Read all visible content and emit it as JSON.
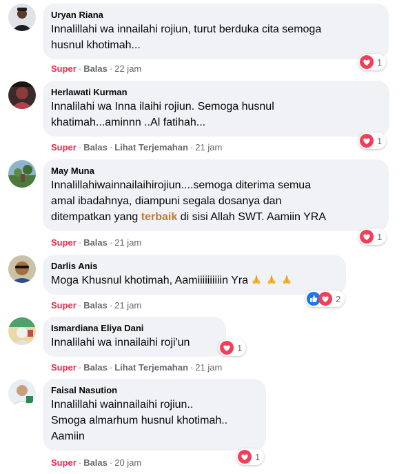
{
  "comments": [
    {
      "author": "Uryan Riana",
      "text": "Innalillahi wa innailahi rojiun, turut berduka cita semoga\nhusnul khotimah...",
      "actions": {
        "super": "Super",
        "reply": "Balas",
        "time": "22 jam"
      },
      "reaction_count": "1"
    },
    {
      "author": "Herlawati Kurman",
      "text": "Innalilahi wa Inna ilaihi rojiun. Semoga husnul\nkhatimah...aminnn ..Al fatihah...",
      "actions": {
        "super": "Super",
        "reply": "Balas",
        "translate": "Lihat Terjemahan",
        "time": "21 jam"
      },
      "reaction_count": "1"
    },
    {
      "author": "May Muna",
      "text_before": "Innalillahiwainnailaihirojiun....semoga diterima semua\namal ibadahnya, diampuni segala dosanya dan\nditempatkan yang ",
      "text_highlight": "terbaik",
      "text_after": " di sisi Allah SWT. Aamiin YRA",
      "actions": {
        "super": "Super",
        "reply": "Balas",
        "time": "21 jam"
      },
      "reaction_count": "1"
    },
    {
      "author": "Darlis Anis",
      "text": "Moga Khusnul khotimah, Aamiiiiiiiiiin Yra",
      "actions": {
        "super": "Super",
        "reply": "Balas",
        "time": "21 jam"
      },
      "reaction_count": "2"
    },
    {
      "author": "Ismardiana Eliya Dani",
      "text": "Innalilahi wa innailaihi roji'un",
      "actions": {
        "super": "Super",
        "reply": "Balas",
        "translate": "Lihat Terjemahan",
        "time": "21 jam"
      },
      "reaction_count": "1"
    },
    {
      "author": "Faisal Nasution",
      "text": "Innalillahi wainnailaihi rojiun..\nSmoga almarhum husnul khotimah..\nAamiin",
      "actions": {
        "super": "Super",
        "reply": "Balas",
        "time": "20 jam"
      },
      "reaction_count": "1"
    }
  ],
  "icons": {
    "reaction_heart": "heart-react-icon",
    "reaction_like": "like-react-icon",
    "emoji": "folded-hands-emoji"
  },
  "colors": {
    "bubble": "#f0f2f5",
    "super": "#f0284a",
    "meta": "#65676b",
    "highlight": "#c8782a",
    "heart": "#f33e58",
    "like": "#1877f2"
  }
}
